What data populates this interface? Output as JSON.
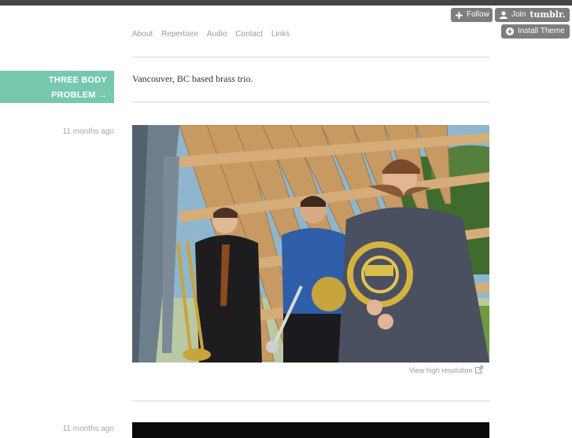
{
  "tumblr_controls": {
    "follow_label": "Follow",
    "join_prefix": "Join",
    "join_brand": "tumblr.",
    "install_label": "Install Theme"
  },
  "nav": {
    "items": [
      "About",
      "Repertoire",
      "Audio",
      "Contact",
      "Links"
    ]
  },
  "blog": {
    "title_line1": "THREE BODY",
    "title_line2": "PROBLEM",
    "title_arrow": "→",
    "description": "Vancouver, BC based brass trio.",
    "accent_color": "#76c8ae"
  },
  "posts": [
    {
      "date": "11 months ago",
      "photo_alt": "three brass players with trombone, trumpet and french horn",
      "hires_label": "View high resolution"
    },
    {
      "date": "11 months ago"
    }
  ],
  "icons": {
    "follow": "plus-icon",
    "join": "user-icon",
    "install": "download-icon",
    "hires": "external-link-icon"
  }
}
